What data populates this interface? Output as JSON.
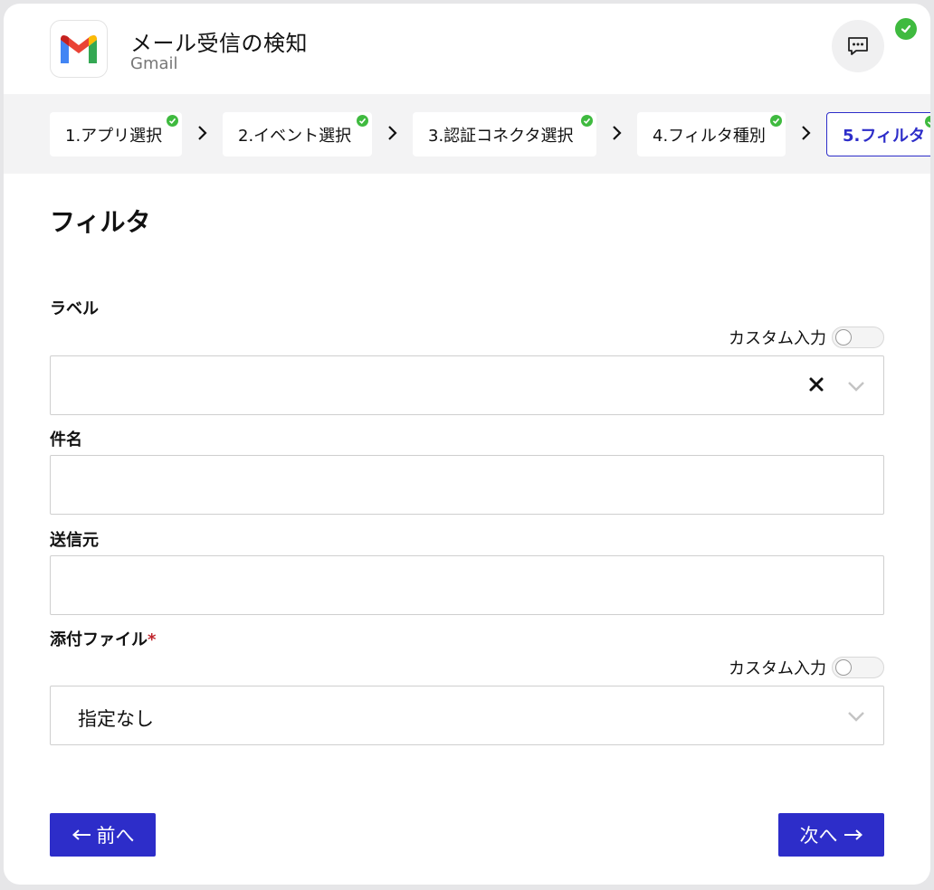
{
  "header": {
    "title": "メール受信の検知",
    "subtitle": "Gmail",
    "logo_icon": "gmail-logo",
    "chat_icon": "chat-bubble-icon",
    "status_color": "#3fba3f"
  },
  "stepper": {
    "steps": [
      {
        "label": "1.アプリ選択",
        "done": true
      },
      {
        "label": "2.イベント選択",
        "done": true
      },
      {
        "label": "3.認証コネクタ選択",
        "done": true
      },
      {
        "label": "4.フィルタ種別",
        "done": true
      },
      {
        "label": "5.フィルタ",
        "done": true,
        "active": true
      }
    ]
  },
  "form": {
    "title": "フィルタ",
    "label_field": {
      "label": "ラベル",
      "custom_toggle_label": "カスタム入力",
      "value": ""
    },
    "subject_field": {
      "label": "件名",
      "value": ""
    },
    "sender_field": {
      "label": "送信元",
      "value": ""
    },
    "attachment_field": {
      "label": "添付ファイル",
      "required_mark": "*",
      "custom_toggle_label": "カスタム入力",
      "value": "指定なし"
    }
  },
  "footer": {
    "prev_label": "前へ",
    "next_label": "次へ"
  },
  "colors": {
    "accent": "#2d2dc9",
    "success": "#3fba3f",
    "required": "#c0262d"
  }
}
